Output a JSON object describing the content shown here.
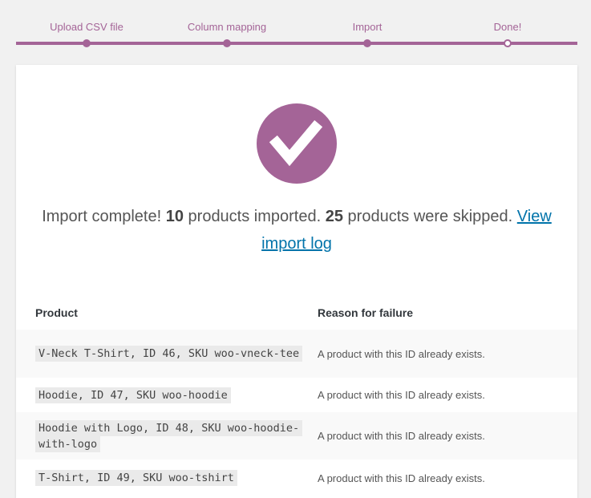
{
  "steps": [
    {
      "label": "Upload CSV file",
      "state": "completed"
    },
    {
      "label": "Column mapping",
      "state": "completed"
    },
    {
      "label": "Import",
      "state": "completed"
    },
    {
      "label": "Done!",
      "state": "active"
    }
  ],
  "colors": {
    "accent": "#a46497",
    "link": "#0073aa"
  },
  "result": {
    "icon": "checkmark-icon",
    "prefix": "Import complete!",
    "imported_count": "10",
    "imported_text": "products imported.",
    "skipped_count": "25",
    "skipped_text": "products were skipped.",
    "log_link": "View import log"
  },
  "table": {
    "headers": {
      "product": "Product",
      "reason": "Reason for failure"
    },
    "rows": [
      {
        "product": "V-Neck T-Shirt, ID 46, SKU woo-vneck-tee",
        "reason": "A product with this ID already exists."
      },
      {
        "product": "Hoodie, ID 47, SKU woo-hoodie",
        "reason": "A product with this ID already exists."
      },
      {
        "product": "Hoodie with Logo, ID 48, SKU woo-hoodie-with-logo",
        "reason": "A product with this ID already exists."
      },
      {
        "product": "T-Shirt, ID 49, SKU woo-tshirt",
        "reason": "A product with this ID already exists."
      }
    ]
  }
}
